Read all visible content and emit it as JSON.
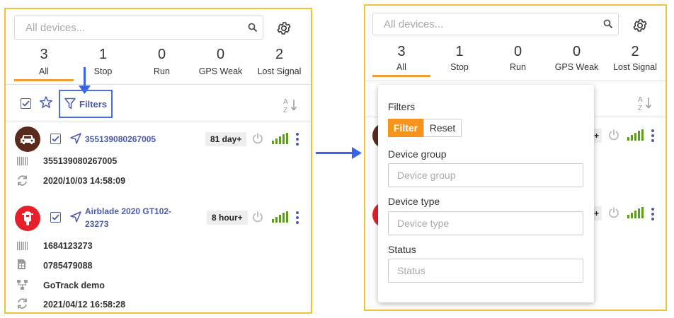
{
  "search": {
    "placeholder": "All devices..."
  },
  "stats": [
    {
      "count": "3",
      "label": "All"
    },
    {
      "count": "1",
      "label": "Stop"
    },
    {
      "count": "0",
      "label": "Run"
    },
    {
      "count": "0",
      "label": "GPS Weak"
    },
    {
      "count": "2",
      "label": "Lost Signal"
    }
  ],
  "toolbar": {
    "filters_label": "Filters"
  },
  "devices": [
    {
      "name": "355139080267005",
      "badge": "81 day+",
      "imei": "355139080267005",
      "updated": "2020/10/03 14:58:09"
    },
    {
      "name_line1": "Airblade 2020 GT102-",
      "name_line2": "23273",
      "badge": "8 hour+",
      "imei": "1684123273",
      "phone": "0785479088",
      "group": "GoTrack demo",
      "updated": "2021/04/12 16:58:28"
    }
  ],
  "filter_popup": {
    "title": "Filters",
    "filter_button": "Filter",
    "reset_button": "Reset",
    "device_group_label": "Device group",
    "device_group_placeholder": "Device group",
    "device_type_label": "Device type",
    "device_type_placeholder": "Device type",
    "status_label": "Status",
    "status_placeholder": "Status"
  },
  "colors": {
    "accent": "#f39c32",
    "link": "#4a5ab0",
    "annotation": "#3a64e8",
    "signal": "#5a9e1a"
  },
  "icons": [
    "search-icon",
    "gear-icon",
    "checkbox-icon",
    "star-icon",
    "filter-icon",
    "sort-az-icon",
    "car-icon",
    "scooter-icon",
    "navigation-icon",
    "power-icon",
    "signal-icon",
    "more-icon",
    "barcode-icon",
    "refresh-icon",
    "sim-icon",
    "group-icon"
  ]
}
